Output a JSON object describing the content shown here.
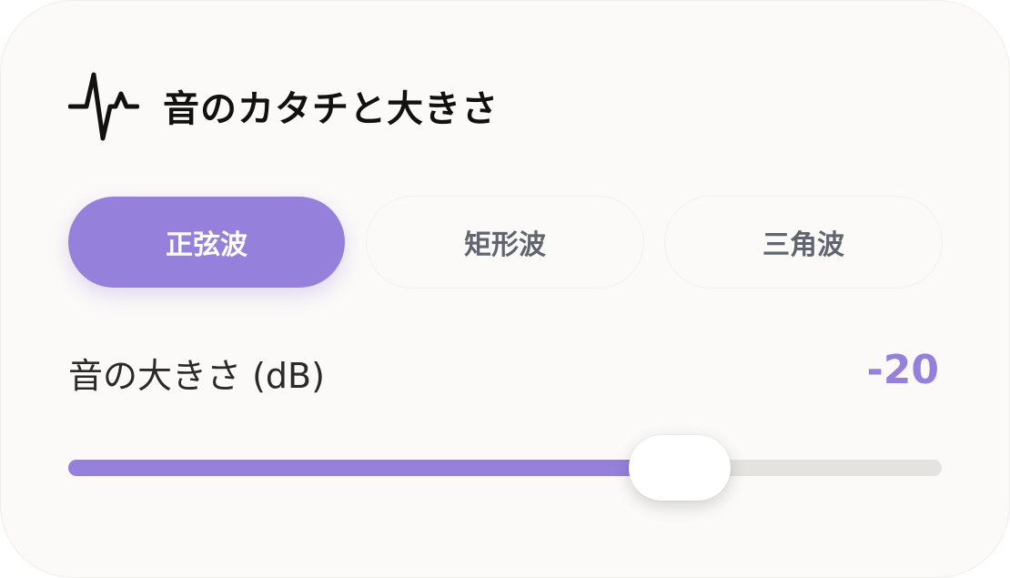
{
  "header": {
    "title": "音のカタチと大きさ",
    "icon": "waveform-icon"
  },
  "waveform_tabs": [
    {
      "label": "正弦波",
      "selected": true
    },
    {
      "label": "矩形波",
      "selected": false
    },
    {
      "label": "三角波",
      "selected": false
    }
  ],
  "volume": {
    "label": "音の大きさ (dB)",
    "value": "-20",
    "slider_fraction": 0.7
  },
  "colors": {
    "accent": "#9580dc",
    "card_background": "#fbfaf8",
    "track": "#e4e3e0"
  }
}
